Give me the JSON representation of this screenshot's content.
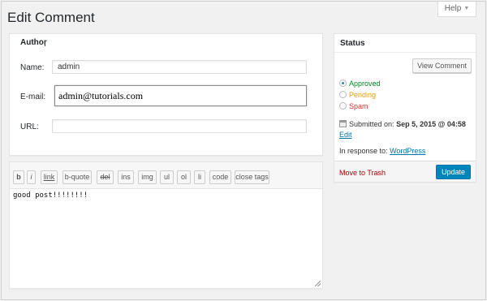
{
  "page": {
    "title": "Edit Comment",
    "help_label": "Help"
  },
  "author": {
    "title": "Author",
    "name_label": "Name:",
    "name_value": "admin",
    "email_label": "E-mail:",
    "email_value": "admin@tutorials.com",
    "url_label": "URL:",
    "url_value": ""
  },
  "editor": {
    "buttons": [
      "b",
      "i",
      "link",
      "b-quote",
      "del",
      "ins",
      "img",
      "ul",
      "ol",
      "li",
      "code",
      "close tags"
    ],
    "content": "good post!!!!!!!!"
  },
  "status": {
    "title": "Status",
    "view_comment_label": "View Comment",
    "options": [
      {
        "label": "Approved",
        "checked": true,
        "color": "#008a20"
      },
      {
        "label": "Pending",
        "checked": false,
        "color": "#e6a10e"
      },
      {
        "label": "Spam",
        "checked": false,
        "color": "#c0392b"
      }
    ],
    "submitted_prefix": "Submitted on:",
    "submitted_date": "Sep 5, 2015 @ 04:58",
    "edit_label": "Edit",
    "in_response_prefix": "In response to:",
    "in_response_link": "WordPress",
    "trash_label": "Move to Trash",
    "update_label": "Update"
  },
  "colors": {
    "accent": "#0085ba",
    "link": "#0073aa",
    "trash": "#a00"
  }
}
